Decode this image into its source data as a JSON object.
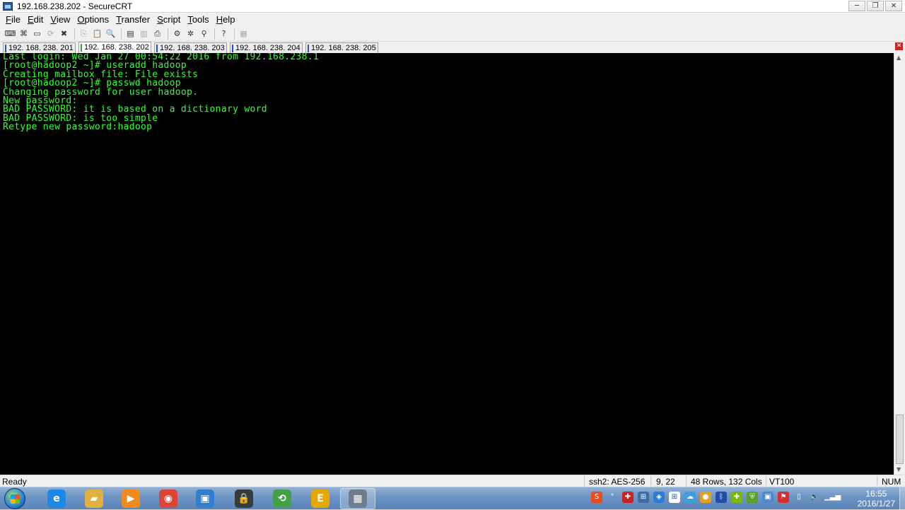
{
  "window": {
    "title": "192.168.238.202 - SecureCRT",
    "minimize": "─",
    "restore": "❐",
    "close": "✕"
  },
  "menu": [
    "File",
    "Edit",
    "View",
    "Options",
    "Transfer",
    "Script",
    "Tools",
    "Help"
  ],
  "toolbar": {
    "buttons": [
      {
        "icon": "connect-icon",
        "glyph": "⌨"
      },
      {
        "icon": "quick-connect-icon",
        "glyph": "⌘"
      },
      {
        "icon": "connect-in-tab-icon",
        "glyph": "▭"
      },
      {
        "icon": "reconnect-icon",
        "glyph": "⟳",
        "dim": true
      },
      {
        "icon": "disconnect-icon",
        "glyph": "✖"
      },
      {
        "sep": true
      },
      {
        "icon": "copy-icon",
        "glyph": "⎘",
        "dim": true
      },
      {
        "icon": "paste-icon",
        "glyph": "📋",
        "dim": true
      },
      {
        "icon": "find-icon",
        "glyph": "🔍"
      },
      {
        "sep": true
      },
      {
        "icon": "print-screen-icon",
        "glyph": "▤"
      },
      {
        "icon": "print-selection-icon",
        "glyph": "▥",
        "dim": true
      },
      {
        "icon": "print-icon",
        "glyph": "⎙"
      },
      {
        "sep": true
      },
      {
        "icon": "session-options-icon",
        "glyph": "⚙"
      },
      {
        "icon": "global-options-icon",
        "glyph": "✲"
      },
      {
        "icon": "keymap-icon",
        "glyph": "⚲"
      },
      {
        "sep": true
      },
      {
        "icon": "help-icon",
        "glyph": "?"
      },
      {
        "sep": true
      },
      {
        "icon": "sftp-icon",
        "glyph": "▦",
        "dim": true
      }
    ]
  },
  "tabs": [
    {
      "label": "192. 168. 238. 201",
      "active": false
    },
    {
      "label": "192. 168. 238. 202",
      "active": true
    },
    {
      "label": "192. 168. 238. 203",
      "active": false
    },
    {
      "label": "192. 168. 238. 204",
      "active": false
    },
    {
      "label": "192. 168. 238. 205",
      "active": false
    }
  ],
  "tab_close": "✕",
  "terminal": {
    "lines": [
      "Last login: Wed Jan 27 00:54:22 2016 from 192.168.238.1",
      "[root@hadoop2 ~]# useradd hadoop",
      "Creating mailbox file: File exists",
      "[root@hadoop2 ~]# passwd hadoop",
      "Changing password for user hadoop.",
      "New password:",
      "BAD PASSWORD: it is based on a dictionary word",
      "BAD PASSWORD: is too simple",
      "Retype new password:hadoop"
    ],
    "foreground": "#33ff33",
    "background": "#000000"
  },
  "scrollbar": {
    "up_arrow": "▲",
    "down_arrow": "▼"
  },
  "status": {
    "ready": "Ready",
    "cipher": "ssh2: AES-256",
    "cursor": "9,  22",
    "size": "48 Rows, 132 Cols",
    "emulation": "VT100",
    "num": "NUM"
  },
  "taskbar": {
    "apps": [
      {
        "name": "internet-explorer",
        "glyph": "e",
        "color": "#1e88e5"
      },
      {
        "name": "file-explorer",
        "glyph": "▰",
        "color": "#e0b040"
      },
      {
        "name": "media-player",
        "glyph": "▶",
        "color": "#f08a1c"
      },
      {
        "name": "chrome",
        "glyph": "◉",
        "color": "#db4437"
      },
      {
        "name": "vmware",
        "glyph": "▣",
        "color": "#2f7fd0"
      },
      {
        "name": "lock-app",
        "glyph": "🔒",
        "color": "#3a3a3a"
      },
      {
        "name": "green-app",
        "glyph": "⟲",
        "color": "#43a047"
      },
      {
        "name": "e-app",
        "glyph": "E",
        "color": "#e6a700"
      },
      {
        "name": "securecrt",
        "glyph": "▦",
        "color": "#6d7d8f"
      }
    ],
    "clock_time": "16:55",
    "clock_date": "2016/1/27"
  }
}
